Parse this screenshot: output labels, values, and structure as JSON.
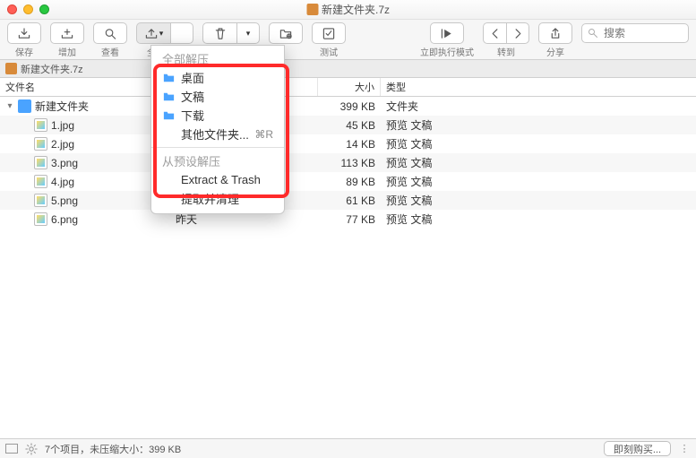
{
  "window": {
    "title": "新建文件夹.7z"
  },
  "toolbar": {
    "save": "保存",
    "add": "增加",
    "view": "查看",
    "extract_all": "全部解压",
    "test": "测试",
    "run_mode": "立即执行模式",
    "goto": "转到",
    "share": "分享",
    "search_placeholder": "搜索"
  },
  "pathbar": {
    "label": "新建文件夹.7z"
  },
  "columns": {
    "name": "文件名",
    "size": "大小",
    "kind": "类型"
  },
  "rows": [
    {
      "indent": 0,
      "expander": true,
      "icon": "folder",
      "name": "新建文件夹",
      "date": "",
      "size": "399 KB",
      "kind": "文件夹"
    },
    {
      "indent": 1,
      "icon": "img",
      "name": "1.jpg",
      "date": "",
      "size": "45 KB",
      "kind": "预览 文稿"
    },
    {
      "indent": 1,
      "icon": "img",
      "name": "2.jpg",
      "date": "",
      "size": "14 KB",
      "kind": "预览 文稿"
    },
    {
      "indent": 1,
      "icon": "img",
      "name": "3.png",
      "date": "",
      "size": "113 KB",
      "kind": "预览 文稿"
    },
    {
      "indent": 1,
      "icon": "img",
      "name": "4.jpg",
      "date": "",
      "size": "89 KB",
      "kind": "预览 文稿"
    },
    {
      "indent": 1,
      "icon": "img",
      "name": "5.png",
      "date": "昨天",
      "size": "61 KB",
      "kind": "预览 文稿"
    },
    {
      "indent": 1,
      "icon": "img",
      "name": "6.png",
      "date": "昨天",
      "size": "77 KB",
      "kind": "预览 文稿"
    }
  ],
  "menu": {
    "section1": "全部解压",
    "items1": [
      {
        "icon": "folder",
        "label": "桌面"
      },
      {
        "icon": "folder",
        "label": "文稿"
      },
      {
        "icon": "folder",
        "label": "下载"
      },
      {
        "icon": "",
        "label": "其他文件夹...",
        "shortcut": "⌘R"
      }
    ],
    "section2": "从预设解压",
    "items2": [
      {
        "label": "Extract & Trash"
      },
      {
        "label": "提取并清理"
      }
    ]
  },
  "status": {
    "summary": "7个项目，未压缩大小：399 KB",
    "buy": "即刻购买..."
  }
}
